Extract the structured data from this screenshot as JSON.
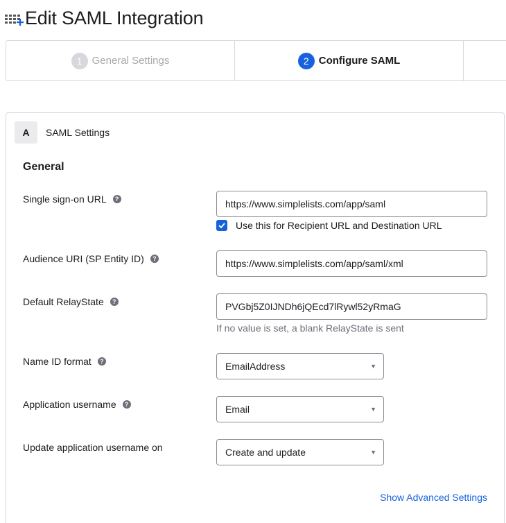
{
  "header": {
    "title": "Edit SAML Integration",
    "app_icon": "app-grid-add-icon",
    "accent": "#1662dd"
  },
  "wizard": {
    "steps": [
      {
        "number": "1",
        "label": "General Settings",
        "state": "inactive"
      },
      {
        "number": "2",
        "label": "Configure SAML",
        "state": "active"
      }
    ]
  },
  "section": {
    "badge": "A",
    "title": "SAML Settings",
    "group_title": "General"
  },
  "fields": {
    "sso_url": {
      "label": "Single sign-on URL",
      "value": "https://www.simplelists.com/app/saml"
    },
    "recipient_checkbox": {
      "label": "Use this for Recipient URL and Destination URL",
      "checked": true
    },
    "audience_uri": {
      "label": "Audience URI (SP Entity ID)",
      "value": "https://www.simplelists.com/app/saml/xml"
    },
    "relay_state": {
      "label": "Default RelayState",
      "value": "PVGbj5Z0IJNDh6jQEcd7lRywl52yRmaG",
      "hint": "If no value is set, a blank RelayState is sent"
    },
    "name_id_format": {
      "label": "Name ID format",
      "value": "EmailAddress"
    },
    "app_username": {
      "label": "Application username",
      "value": "Email"
    },
    "update_username_on": {
      "label": "Update application username on",
      "value": "Create and update"
    }
  },
  "links": {
    "advanced": "Show Advanced Settings"
  }
}
